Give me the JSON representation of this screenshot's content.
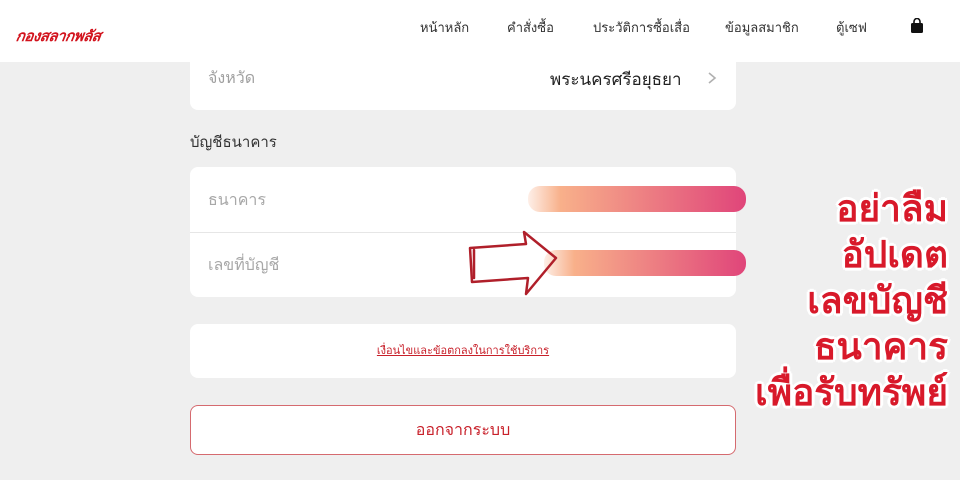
{
  "header": {
    "logo_text": "กองสลากพลัส",
    "nav": [
      "หน้าหลัก",
      "คำสั่งซื้อ",
      "ประวัติการซื้อเสื่อ",
      "ข้อมูลสมาชิก",
      "ตู้เซฟ"
    ],
    "bag_icon": "shopping-bag-icon"
  },
  "form": {
    "province_label": "จังหวัด",
    "province_value": "พระนครศรีอยุธยา",
    "bank_section_title": "บัญชีธนาคาร",
    "bank_placeholder": "ธนาคาร",
    "account_placeholder": "เลขที่บัญชี",
    "terms_link": "เงื่อนไขและข้อตกลงในการใช้บริการ",
    "logout_label": "ออกจากระบบ"
  },
  "callout": {
    "lines": [
      "อย่าลืม",
      "อัปเดต",
      "เลขบัญชี",
      "ธนาคาร",
      "เพื่อรับทรัพย์"
    ]
  },
  "colors": {
    "brand_red": "#d2121c",
    "highlight_start": "#f8b08a",
    "highlight_end": "#e0457a"
  }
}
